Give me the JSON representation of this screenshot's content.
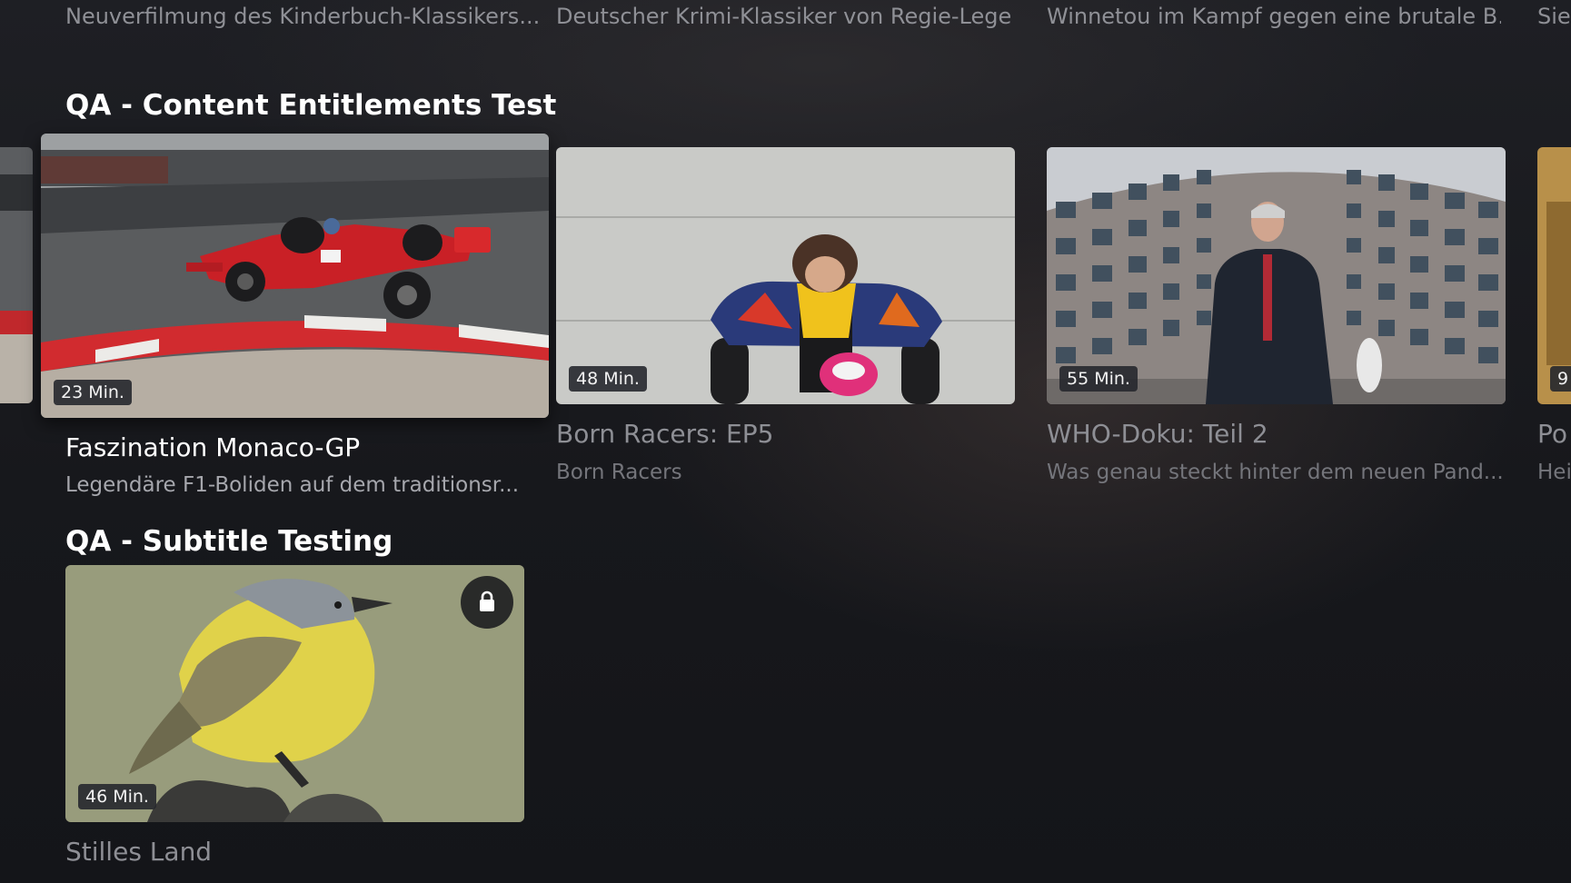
{
  "top_row": {
    "subtitles": [
      "Neuverfilmung des Kinderbuch-Klassikers...",
      "Deutscher Krimi-Klassiker von Regie-Lege...",
      "Winnetou im Kampf gegen eine brutale B...",
      "Sie"
    ]
  },
  "rows": [
    {
      "title": "QA - Content Entitlements Test",
      "cards": [
        {
          "duration": "23 Min.",
          "title": "Faszination Monaco-GP",
          "subtitle": "Legendäre F1-Boliden auf dem traditionsr...",
          "image": "f1-race-car-monaco"
        },
        {
          "duration": "48 Min.",
          "title": "Born Racers: EP5",
          "subtitle": "Born Racers",
          "image": "young-racer-with-helmet"
        },
        {
          "duration": "55 Min.",
          "title": "WHO-Doku: Teil 2",
          "subtitle": "Was genau steckt hinter dem neuen Pand...",
          "image": "man-in-circular-building"
        },
        {
          "duration": "9",
          "title": "Po",
          "subtitle": "Hei",
          "image": "partial-thumbnail"
        }
      ]
    },
    {
      "title": "QA - Subtitle Testing",
      "cards": [
        {
          "duration": "46 Min.",
          "title": "Stilles Land",
          "image": "yellow-bird-on-branch",
          "locked": true,
          "lock_icon": "lock-icon"
        }
      ]
    }
  ],
  "colors": {
    "background": "#17181c",
    "title_focused": "#ffffff",
    "title_dim": "#8e8f95",
    "duration_badge": "#26282e"
  }
}
